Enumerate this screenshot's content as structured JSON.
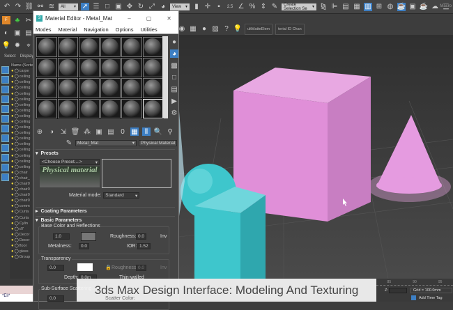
{
  "top_toolbar": {
    "selection_filter": "All",
    "ref_coord": "View",
    "named_selection": "Create Selection Se",
    "snap_label": "2.5",
    "right_label": "Macro"
  },
  "second_toolbar": {
    "buttons": [
      "ultMatteElem",
      "terial ID Chan"
    ]
  },
  "left_panel": {
    "tabs": [
      "Select",
      "Display"
    ],
    "column_header": "Name (Sorted A",
    "items": [
      "carpe",
      "ceiling",
      "ceiling",
      "ceiling",
      "ceiling",
      "ceiling",
      "ceiling",
      "ceiling",
      "ceiling",
      "ceiling",
      "ceiling",
      "ceiling",
      "ceiling",
      "ceiling",
      "ceiling",
      "ceiling",
      "ceiling",
      "ceiling",
      "chair",
      "chair_",
      "chair0",
      "chair0",
      "chair0",
      "chair0",
      "comm",
      "Curta",
      "Curta",
      "Cylin",
      "d7",
      "Decor",
      "Decor",
      "floor",
      "glass",
      "Group"
    ],
    "bottom_field": "*Eli*"
  },
  "material_editor": {
    "title": "Material Editor - Metal_Mat",
    "menu": [
      "Modes",
      "Material",
      "Navigation",
      "Options",
      "Utilities"
    ],
    "slot_count": 24,
    "material_name": "Metal_Mat",
    "material_type": "Physical Material",
    "presets": {
      "header": "Presets",
      "choose": "<Choose Preset....>",
      "logo_text": "Physical material",
      "mode_label": "Material mode:",
      "mode_value": "Standard"
    },
    "coating": {
      "header": "Coating Parameters"
    },
    "basic": {
      "header": "Basic Parameters",
      "group1": "Base Color and Reflections",
      "weight": "1.0",
      "roughness_label": "Roughness:",
      "roughness": "0.0",
      "inv": "Inv",
      "metalness_label": "Metalness:",
      "metalness": "0.0",
      "ior_label": "IOR:",
      "ior": "1.52",
      "group2": "Transparency",
      "trans_weight": "0.0",
      "trans_rough_label": "Roughness:",
      "trans_rough": "0.0",
      "depth_label": "Depth:",
      "depth": "0.0m",
      "thin_walled": "Thin-walled",
      "group3": "Sub-Surface Scattering",
      "sss_weight": "0.0",
      "scatter_label": "Scatter Color:"
    }
  },
  "status": {
    "ruler": [
      "85",
      "90",
      "95"
    ],
    "z_label": "Z:",
    "grid": "Grid = 100.0mm",
    "add_time_tag": "Add Time Tag"
  },
  "caption": "3ds Max Design Interface: Modeling And Texturing",
  "colors": {
    "accent": "#3d7fc4",
    "cube": "#e08fd8",
    "cyan": "#3ec6cc"
  }
}
